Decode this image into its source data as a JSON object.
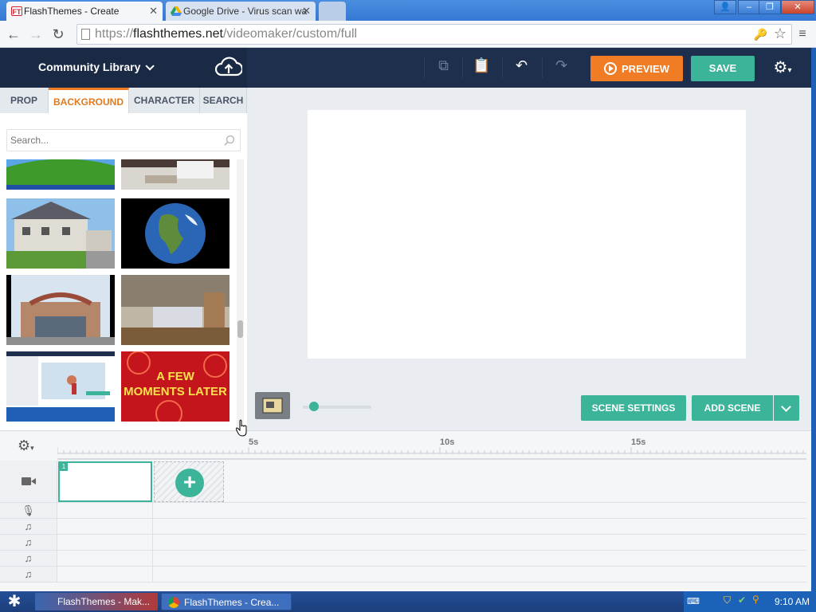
{
  "browser": {
    "tabs": [
      {
        "title": "FlashThemes - Create",
        "favicon": "FT",
        "active": true
      },
      {
        "title": "Google Drive - Virus scan wa",
        "favicon": "drive",
        "active": false
      }
    ],
    "url_prefix": "https://",
    "url_host": "flashthemes.net",
    "url_path": "/videomaker/custom/full",
    "window_controls": [
      "minimize",
      "restore",
      "close"
    ]
  },
  "app": {
    "library_title": "Community Library",
    "preview_label": "PREVIEW",
    "save_label": "SAVE",
    "library_tabs": [
      "PROP",
      "BACKGROUND",
      "CHARACTER",
      "SEARCH"
    ],
    "active_tab": "BACKGROUND",
    "search_placeholder": "Search...",
    "thumbnails": [
      {
        "name": "green-hills",
        "text": ""
      },
      {
        "name": "bedroom-interior",
        "text": ""
      },
      {
        "name": "suburban-house",
        "text": ""
      },
      {
        "name": "earth-globe",
        "text": ""
      },
      {
        "name": "storefront",
        "text": ""
      },
      {
        "name": "bedroom",
        "text": ""
      },
      {
        "name": "video-maker-screenshot",
        "text": ""
      },
      {
        "name": "a-few-moments-later",
        "text": "A FEW MOMENTS LATER"
      }
    ],
    "scene_settings_label": "SCENE SETTINGS",
    "add_scene_label": "ADD SCENE",
    "timeline": {
      "ticks": [
        "5s",
        "10s",
        "15s"
      ],
      "scene_number": "1",
      "rows": [
        "camera",
        "microphone",
        "music",
        "music",
        "music",
        "music"
      ]
    }
  },
  "taskbar": {
    "tasks": [
      "FlashThemes - Mak...",
      "FlashThemes - Crea..."
    ],
    "clock": "9:10 AM"
  },
  "colors": {
    "accent_orange": "#f07d26",
    "accent_green": "#3cb49a",
    "header_dark": "#1e2f4d"
  }
}
